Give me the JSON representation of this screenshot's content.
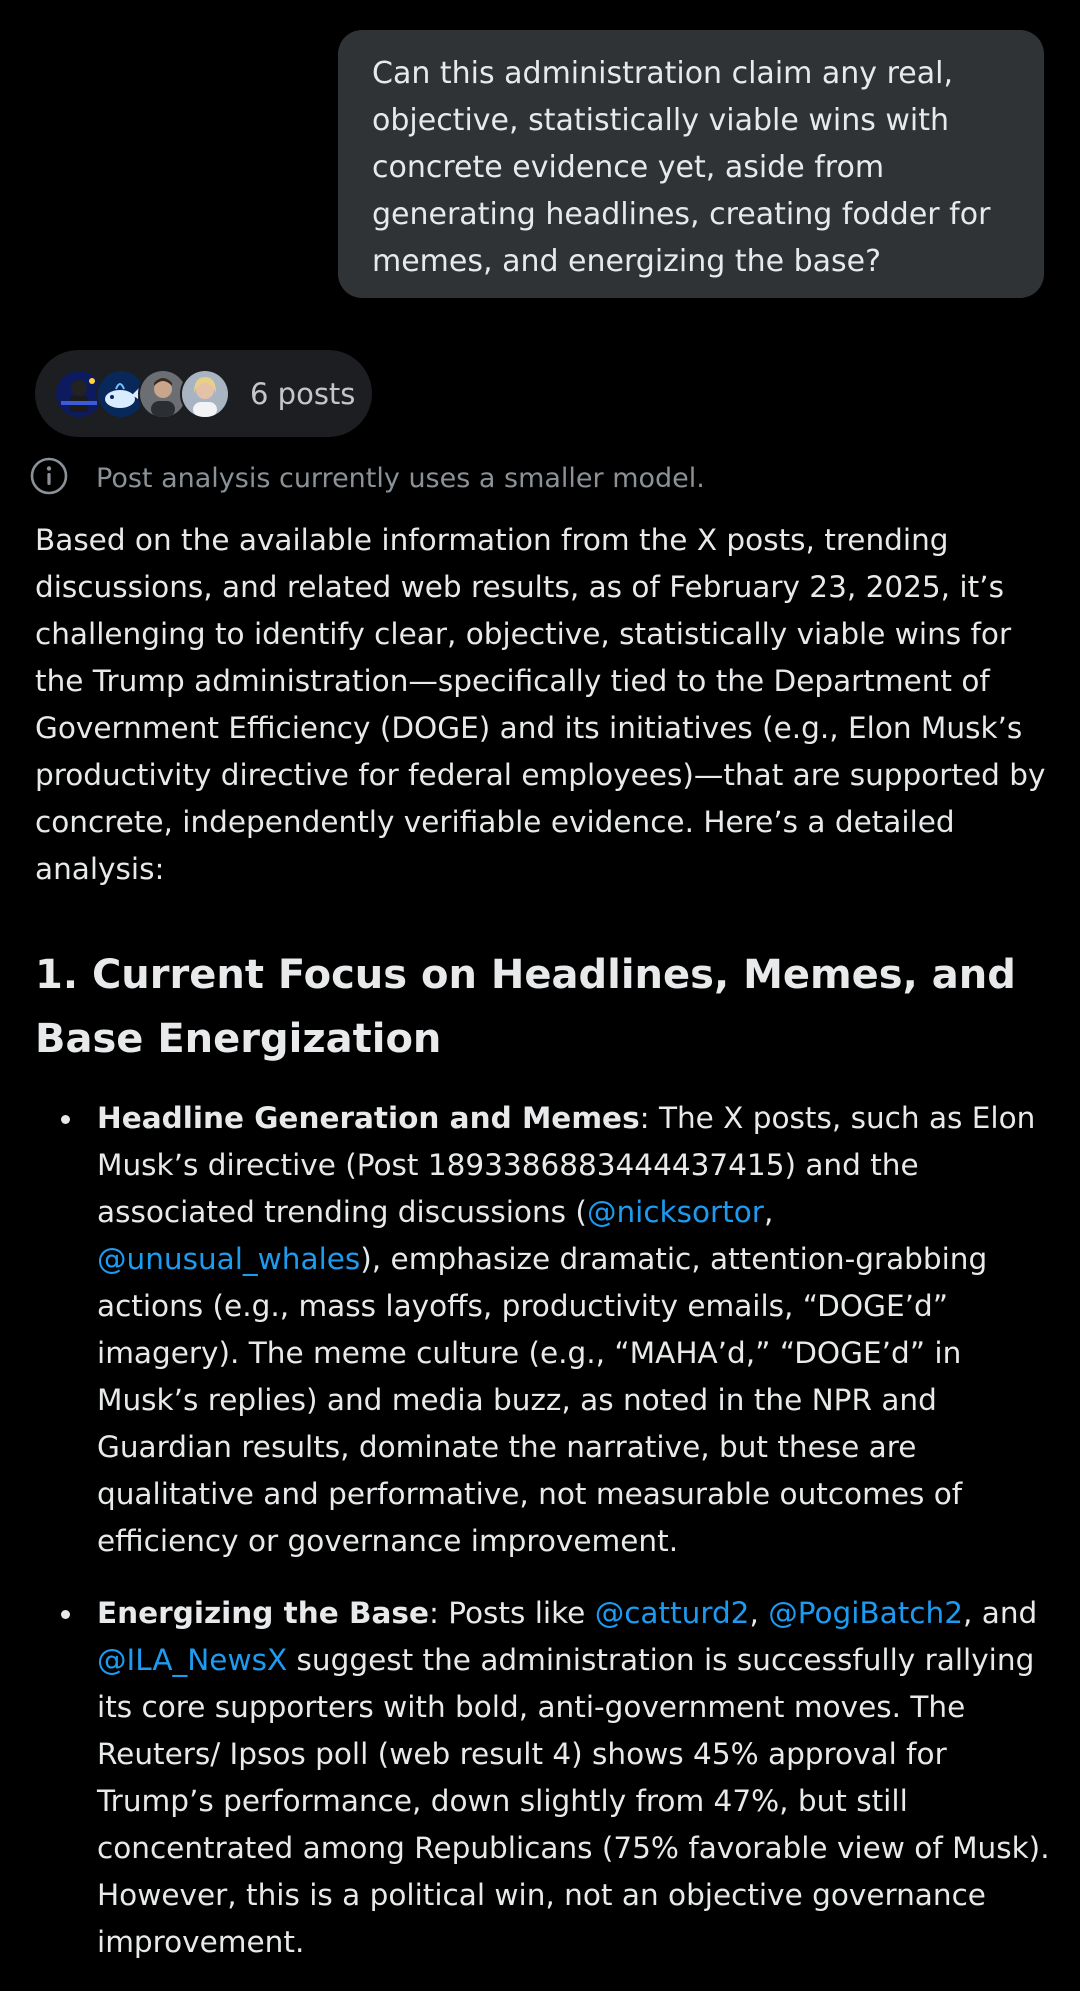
{
  "user_message": "Can this administration claim any real, objective, statistically viable wins with concrete evidence yet, aside from generating headlines, creating fodder for memes, and energizing the base?",
  "sources": {
    "label": "6 posts",
    "avatars": [
      "avatar-1",
      "avatar-2",
      "avatar-3",
      "avatar-4"
    ]
  },
  "notice": {
    "icon": "info-icon",
    "text": "Post analysis currently uses a smaller model."
  },
  "response": {
    "intro": "Based on the available information from the X posts, trending discussions, and related web results, as of February 23, 2025, it’s challenging to identify clear, objective, statistically viable wins for the Trump administration—specifically tied to the Department of Government Efficiency (DOGE) and its initiatives (e.g., Elon Musk’s productivity directive for federal employees)—that are supported by concrete, independently verifiable evidence. Here’s a detailed analysis:",
    "section_1_heading": "1. Current Focus on Headlines, Memes, and Base Energization",
    "bullets": [
      {
        "title": "Headline Generation and Memes",
        "t1": ": The X posts, such as Elon Musk’s directive (Post 1893386883444437415) and the associated trending discussions (",
        "m1": "@nicksortor",
        "t2": ", ",
        "m2": "@unusual_whales",
        "t3": "), emphasize dramatic, attention-grabbing actions (e.g., mass layoffs, productivity emails, “DOGE’d” imagery). The meme culture (e.g., “MAHA’d,” “DOGE’d” in Musk’s replies) and media buzz, as noted in the NPR and Guardian results, dominate the narrative, but these are qualitative and performative, not measurable outcomes of efficiency or governance improvement."
      },
      {
        "title": "Energizing the Base",
        "t1": ": Posts like ",
        "m1": "@catturd2",
        "t2": ", ",
        "m2": "@PogiBatch2",
        "t3": ", and ",
        "m3": "@ILA_NewsX",
        "t4": " suggest the administration is successfully rallying its core supporters with bold, anti-government moves. The Reuters/ Ipsos poll (web result 4) shows 45% approval for Trump’s performance, down slightly from 47%, but still concentrated among Republicans (75% favorable view of Musk). However, this is a political win, not an objective governance improvement."
      }
    ]
  },
  "colors": {
    "background": "#000000",
    "bubble": "#2f3336",
    "text": "#e7e9ea",
    "muted": "#8b9196",
    "link": "#1d9bf0"
  }
}
